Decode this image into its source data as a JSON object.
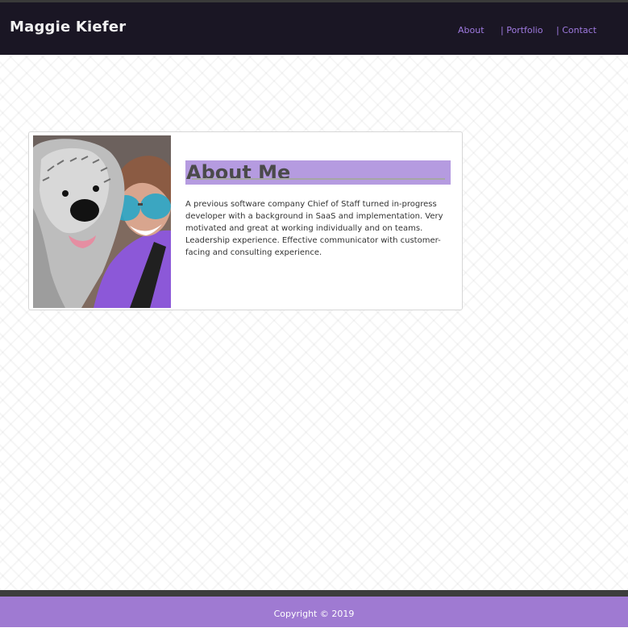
{
  "header": {
    "brand": "Maggie Kiefer",
    "nav": [
      {
        "label": "About"
      },
      {
        "label": "| Portfolio"
      },
      {
        "label": "| Contact"
      }
    ]
  },
  "about": {
    "title": "About Me",
    "text": "A previous software company Chief of Staff turned in-progress developer with a background in SaaS and implementation. Very motivated and great at working individually and on teams. Leadership experience. Effective communicator with customer-facing and consulting experience.",
    "photo_alt": ""
  },
  "footer": {
    "copyright": "Copyright © 2019"
  },
  "colors": {
    "header_bg": "#1a1624",
    "nav_link": "#9f7ae0",
    "heading_bg": "#b59be0",
    "footer_bg": "#9f7ad2"
  }
}
